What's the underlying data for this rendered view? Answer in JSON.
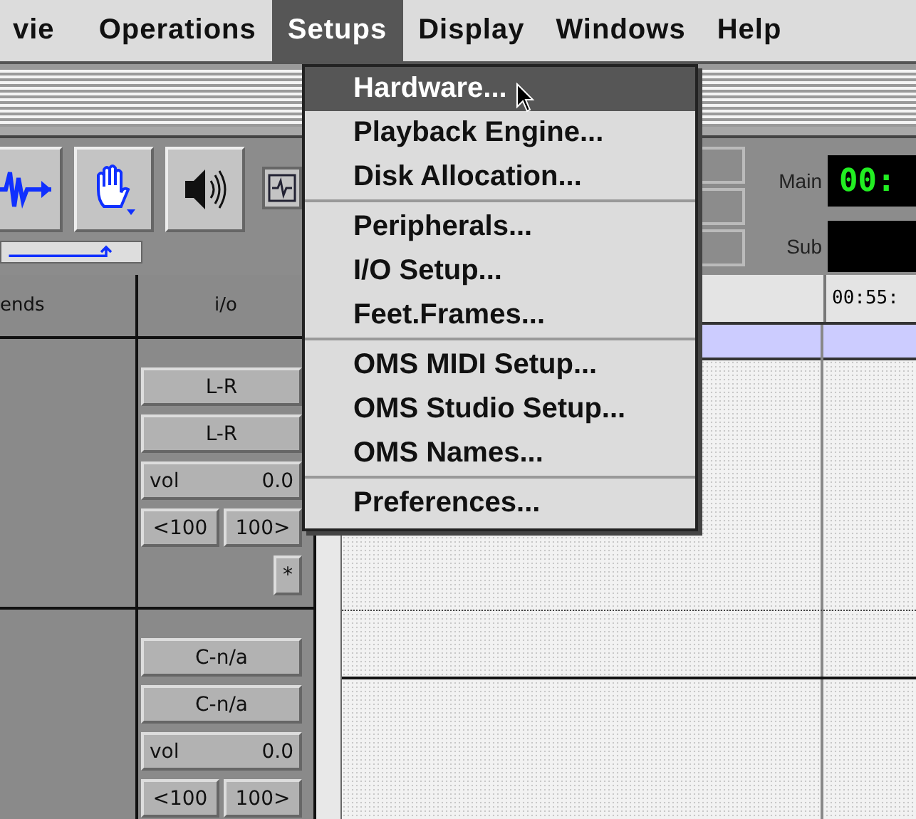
{
  "menubar": [
    {
      "label": "vie",
      "selected": false
    },
    {
      "label": "Operations",
      "selected": false
    },
    {
      "label": "Setups",
      "selected": true
    },
    {
      "label": "Display",
      "selected": false
    },
    {
      "label": "Windows",
      "selected": false
    },
    {
      "label": "Help",
      "selected": false
    }
  ],
  "setups_menu": {
    "groups": [
      [
        {
          "label": "Hardware...",
          "selected": true
        },
        {
          "label": "Playback Engine...",
          "selected": false
        },
        {
          "label": "Disk Allocation...",
          "selected": false
        }
      ],
      [
        {
          "label": "Peripherals...",
          "selected": false
        },
        {
          "label": "I/O Setup...",
          "selected": false
        },
        {
          "label": "Feet.Frames...",
          "selected": false
        }
      ],
      [
        {
          "label": "OMS MIDI Setup...",
          "selected": false
        },
        {
          "label": "OMS Studio Setup...",
          "selected": false
        },
        {
          "label": "OMS Names...",
          "selected": false
        }
      ],
      [
        {
          "label": "Preferences...",
          "selected": false
        }
      ]
    ]
  },
  "counters": [
    {
      "label": "Main",
      "value": "00:"
    },
    {
      "label": "Sub"
    }
  ],
  "columns": {
    "column_1": "ends",
    "io": "i/o"
  },
  "ruler": {
    "time": "00:55:"
  },
  "tracks": [
    {
      "outputs": [
        "L-R",
        "L-R"
      ],
      "volume_label": "vol",
      "volume": "0.0",
      "pan_left": "<100",
      "pan_right": "100>",
      "extra_button": "*"
    },
    {
      "outputs": [
        "C-n/a",
        "C-n/a"
      ],
      "volume_label": "vol",
      "volume": "0.0",
      "pan_left": "<100",
      "pan_right": "100>"
    }
  ]
}
